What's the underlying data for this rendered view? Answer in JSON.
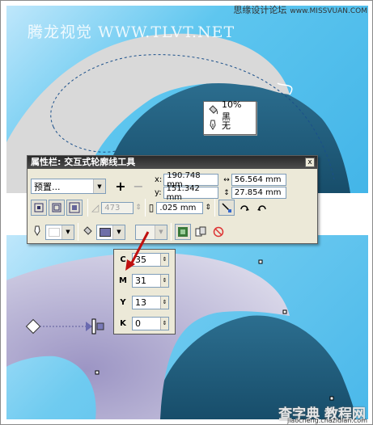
{
  "header": {
    "watermark": "腾龙视觉 WWW.TLVT.NET",
    "site_name": "思缘设计论坛",
    "site_url": "www.MISSVUAN.COM"
  },
  "tooltip": {
    "row1": "10% 黑",
    "row2": "无"
  },
  "property_bar": {
    "title": "属性栏: 交互式轮廓线工具",
    "close_label": "x",
    "preset_value": "预置...",
    "x_label": "x:",
    "x_value": "190.748 mm",
    "y_label": "y:",
    "y_value": "151.342 mm",
    "w_value": "56.564 mm",
    "h_value": "27.854 mm",
    "steps_value": "473",
    "offset_value": ".025 mm"
  },
  "cmyk": {
    "c_label": "C",
    "c_value": "35",
    "m_label": "M",
    "m_value": "31",
    "y_label": "Y",
    "y_value": "13",
    "k_label": "K",
    "k_value": "0"
  },
  "footer": {
    "brand": "查字典 教程网",
    "url": "jiaocheng.chazidian.com"
  },
  "colors": {
    "sky": "#43b5e8",
    "shape_dark": "#1f5a7a",
    "arc_gray": "#d8d8d8",
    "arc_lavender": "#b9b4d3"
  }
}
